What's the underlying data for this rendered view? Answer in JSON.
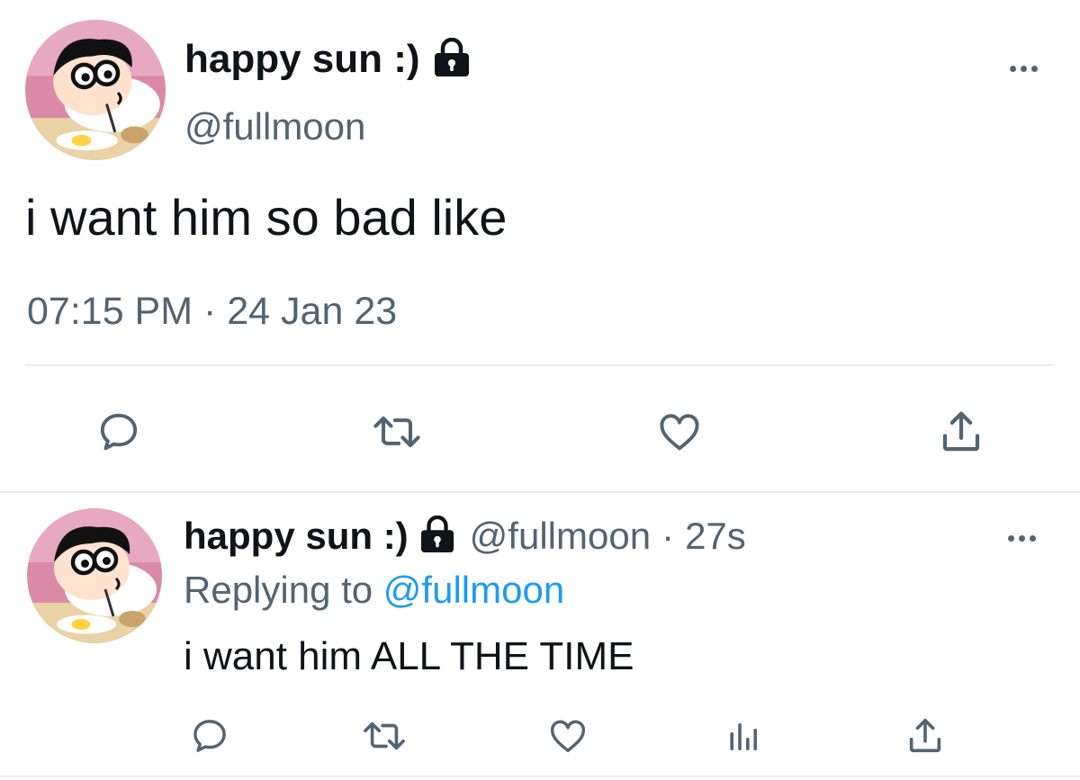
{
  "main_tweet": {
    "display_name": "happy sun :)",
    "handle": "@fullmoon",
    "text": "i want him so bad like",
    "timestamp": "07:15 PM · 24 Jan 23",
    "icons": {
      "locked": "lock-icon",
      "more": "more-dots-icon",
      "actions": [
        "reply-icon",
        "retweet-icon",
        "like-icon",
        "share-icon"
      ]
    }
  },
  "reply_tweet": {
    "display_name": "happy sun :)",
    "handle": "@fullmoon",
    "separator": "·",
    "age": "27s",
    "replying_prefix": "Replying to",
    "replying_handle": "@fullmoon",
    "text": "i want him ALL THE TIME",
    "icons": {
      "locked": "lock-icon",
      "more": "more-dots-icon",
      "actions": [
        "reply-icon",
        "retweet-icon",
        "like-icon",
        "analytics-icon",
        "share-icon"
      ]
    }
  },
  "colors": {
    "text_primary": "#0f1419",
    "text_secondary": "#536471",
    "link": "#1d9bf0",
    "icon": "#536471",
    "divider": "#e9ecef"
  }
}
